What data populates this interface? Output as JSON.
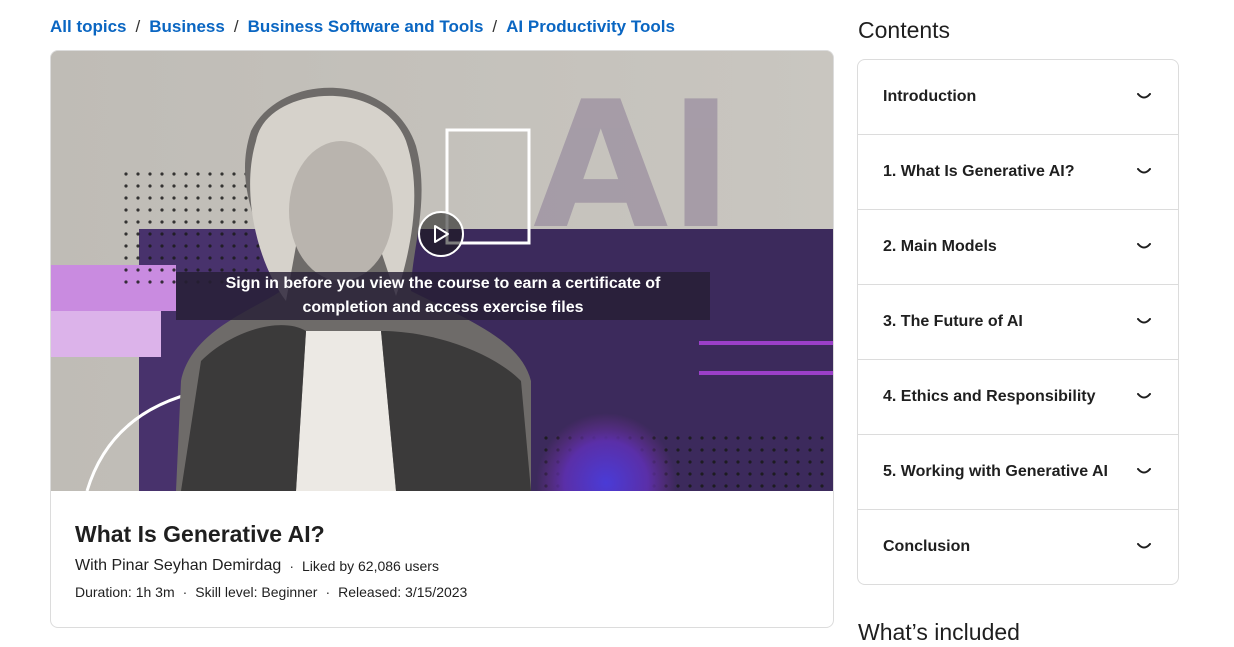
{
  "breadcrumb": {
    "items": [
      "All topics",
      "Business",
      "Business Software and Tools",
      "AI Productivity Tools"
    ],
    "separator": "/"
  },
  "video": {
    "thumbnail_text": "AI",
    "signin_message": "Sign in before you view the course to earn a certificate of completion and access exercise files",
    "play_icon": "play-icon"
  },
  "course": {
    "title": "What Is Generative AI?",
    "instructor": "With Pinar Seyhan Demirdag",
    "likes": "Liked by 62,086 users",
    "duration": "Duration: 1h 3m",
    "skill_level": "Skill level: Beginner",
    "released": "Released: 3/15/2023",
    "separator": "·"
  },
  "contents": {
    "heading": "Contents",
    "sections": [
      {
        "label": "Introduction"
      },
      {
        "label": "1. What Is Generative AI?"
      },
      {
        "label": "2. Main Models"
      },
      {
        "label": "3. The Future of AI"
      },
      {
        "label": "4. Ethics and Responsibility"
      },
      {
        "label": "5. Working with Generative AI"
      },
      {
        "label": "Conclusion"
      }
    ],
    "chevron_icon": "chevron-down-icon"
  },
  "whats_included": {
    "heading": "What’s included"
  },
  "colors": {
    "link": "#0a66c2",
    "purple_dark": "#3c2a5c",
    "purple_light": "#c98be0",
    "border": "#dcdcdc"
  }
}
